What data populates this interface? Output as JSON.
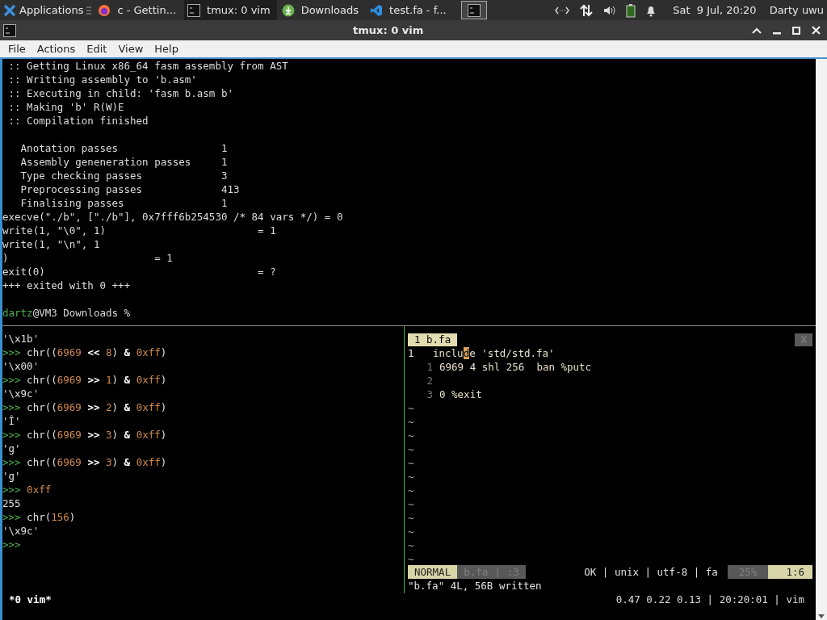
{
  "taskbar": {
    "menu_label": "Applications",
    "tasks": [
      {
        "label": "c - Gettin...",
        "kind": "browser",
        "selected": false
      },
      {
        "label": "tmux: 0 vim",
        "kind": "terminal",
        "selected": true
      },
      {
        "label": "Downloads",
        "kind": "download",
        "selected": false
      },
      {
        "label": "test.fa - f...",
        "kind": "editor",
        "selected": false
      }
    ],
    "clock": "Sat  9 Jul, 20:20",
    "user": "Darty uwu"
  },
  "window": {
    "title": "tmux: 0 vim"
  },
  "menu": [
    "File",
    "Actions",
    "Edit",
    "View",
    "Help"
  ],
  "top_pane": {
    "lines": [
      {
        "kind": "text",
        "text": " :: Getting Linux x86_64 fasm assembly from AST"
      },
      {
        "kind": "text",
        "text": " :: Writting assembly to 'b.asm'"
      },
      {
        "kind": "text",
        "text": " :: Executing in child: 'fasm b.asm b'"
      },
      {
        "kind": "text",
        "text": " :: Making 'b' R(W)E"
      },
      {
        "kind": "text",
        "text": " :: Compilation finished"
      },
      {
        "kind": "blank"
      },
      {
        "kind": "text",
        "text": "   Anotation passes                 1"
      },
      {
        "kind": "text",
        "text": "   Assembly geneneration passes     1"
      },
      {
        "kind": "text",
        "text": "   Type checking passes             3"
      },
      {
        "kind": "text",
        "text": "   Preprocessing passes             413"
      },
      {
        "kind": "text",
        "text": "   Finalising passes                1"
      },
      {
        "kind": "text",
        "text": "execve(\"./b\", [\"./b\"], 0x7fff6b254530 /* 84 vars */) = 0"
      },
      {
        "kind": "text",
        "text": "write(1, \"\\0\", 1)                         = 1"
      },
      {
        "kind": "text",
        "text": "write(1, \"\\n\", 1"
      },
      {
        "kind": "text",
        "text": ")                        = 1"
      },
      {
        "kind": "text",
        "text": "exit(0)                                   = ?"
      },
      {
        "kind": "text",
        "text": "+++ exited with 0 +++"
      },
      {
        "kind": "blank"
      },
      {
        "kind": "shell_prompt",
        "user": "dartz",
        "rest": "@VM3 Downloads %"
      }
    ]
  },
  "python_pane": {
    "lines": [
      {
        "segments": [
          {
            "kind": "text",
            "text": "'\\x1b'"
          }
        ]
      },
      {
        "segments": [
          {
            "kind": "prompt",
            "text": ">>> "
          },
          {
            "kind": "text",
            "text": "chr(("
          },
          {
            "kind": "num",
            "text": "6969"
          },
          {
            "kind": "op",
            "text": " << "
          },
          {
            "kind": "num",
            "text": "8"
          },
          {
            "kind": "text",
            "text": ") "
          },
          {
            "kind": "op",
            "text": "& "
          },
          {
            "kind": "num",
            "text": "0xff"
          },
          {
            "kind": "text",
            "text": ")"
          }
        ]
      },
      {
        "segments": [
          {
            "kind": "text",
            "text": "'\\x00'"
          }
        ]
      },
      {
        "segments": [
          {
            "kind": "prompt",
            "text": ">>> "
          },
          {
            "kind": "text",
            "text": "chr(("
          },
          {
            "kind": "num",
            "text": "6969"
          },
          {
            "kind": "op",
            "text": " >> "
          },
          {
            "kind": "num",
            "text": "1"
          },
          {
            "kind": "text",
            "text": ") "
          },
          {
            "kind": "op",
            "text": "& "
          },
          {
            "kind": "num",
            "text": "0xff"
          },
          {
            "kind": "text",
            "text": ")"
          }
        ]
      },
      {
        "segments": [
          {
            "kind": "text",
            "text": "'\\x9c'"
          }
        ]
      },
      {
        "segments": [
          {
            "kind": "prompt",
            "text": ">>> "
          },
          {
            "kind": "text",
            "text": "chr(("
          },
          {
            "kind": "num",
            "text": "6969"
          },
          {
            "kind": "op",
            "text": " >> "
          },
          {
            "kind": "num",
            "text": "2"
          },
          {
            "kind": "text",
            "text": ") "
          },
          {
            "kind": "op",
            "text": "& "
          },
          {
            "kind": "num",
            "text": "0xff"
          },
          {
            "kind": "text",
            "text": ")"
          }
        ]
      },
      {
        "segments": [
          {
            "kind": "text",
            "text": "'Î'"
          }
        ]
      },
      {
        "segments": [
          {
            "kind": "prompt",
            "text": ">>> "
          },
          {
            "kind": "text",
            "text": "chr(("
          },
          {
            "kind": "num",
            "text": "6969"
          },
          {
            "kind": "op",
            "text": " >> "
          },
          {
            "kind": "num",
            "text": "3"
          },
          {
            "kind": "text",
            "text": ") "
          },
          {
            "kind": "op",
            "text": "& "
          },
          {
            "kind": "num",
            "text": "0xff"
          },
          {
            "kind": "text",
            "text": ")"
          }
        ]
      },
      {
        "segments": [
          {
            "kind": "text",
            "text": "'g'"
          }
        ]
      },
      {
        "segments": [
          {
            "kind": "prompt",
            "text": ">>> "
          },
          {
            "kind": "text",
            "text": "chr(("
          },
          {
            "kind": "num",
            "text": "6969"
          },
          {
            "kind": "op",
            "text": " >> "
          },
          {
            "kind": "num",
            "text": "3"
          },
          {
            "kind": "text",
            "text": ") "
          },
          {
            "kind": "op",
            "text": "& "
          },
          {
            "kind": "num",
            "text": "0xff"
          },
          {
            "kind": "text",
            "text": ")"
          }
        ]
      },
      {
        "segments": [
          {
            "kind": "text",
            "text": "'g'"
          }
        ]
      },
      {
        "segments": [
          {
            "kind": "prompt",
            "text": ">>> "
          },
          {
            "kind": "num",
            "text": "0xff"
          }
        ]
      },
      {
        "segments": [
          {
            "kind": "text",
            "text": "255"
          }
        ]
      },
      {
        "segments": [
          {
            "kind": "prompt",
            "text": ">>> "
          },
          {
            "kind": "text",
            "text": "chr("
          },
          {
            "kind": "num",
            "text": "156"
          },
          {
            "kind": "text",
            "text": ")"
          }
        ]
      },
      {
        "segments": [
          {
            "kind": "text",
            "text": "'\\x9c'"
          }
        ]
      },
      {
        "segments": [
          {
            "kind": "prompt",
            "text": ">>>"
          }
        ]
      }
    ]
  },
  "vim": {
    "tab": "1 b.fa",
    "close": "X",
    "lines": [
      {
        "number": "1",
        "current": true,
        "before": "inclu",
        "cursor": "d",
        "after": "e 'std/std.fa'"
      },
      {
        "number": "1",
        "current": false,
        "before": "6969 4 shl 256  ban %putc"
      },
      {
        "number": "2",
        "current": false
      },
      {
        "number": "3",
        "current": false,
        "before": "0 %exit"
      }
    ],
    "filler": [
      "~",
      "~",
      "~",
      "~",
      "~",
      "~",
      "~",
      "~",
      "~",
      "~",
      "~",
      "~"
    ],
    "status": {
      "mode": "NORMAL",
      "file": "b.fa",
      "sep": "|",
      "line": ":3",
      "info": "OK | unix | utf-8 | fa",
      "percent": "25%",
      "position": "1:6"
    },
    "message": "\"b.fa\" 4L, 56B written"
  },
  "tmux_status": {
    "window": "*0 vim*",
    "right": "0.47 0.22 0.13 | 20:20:01 | vim"
  }
}
